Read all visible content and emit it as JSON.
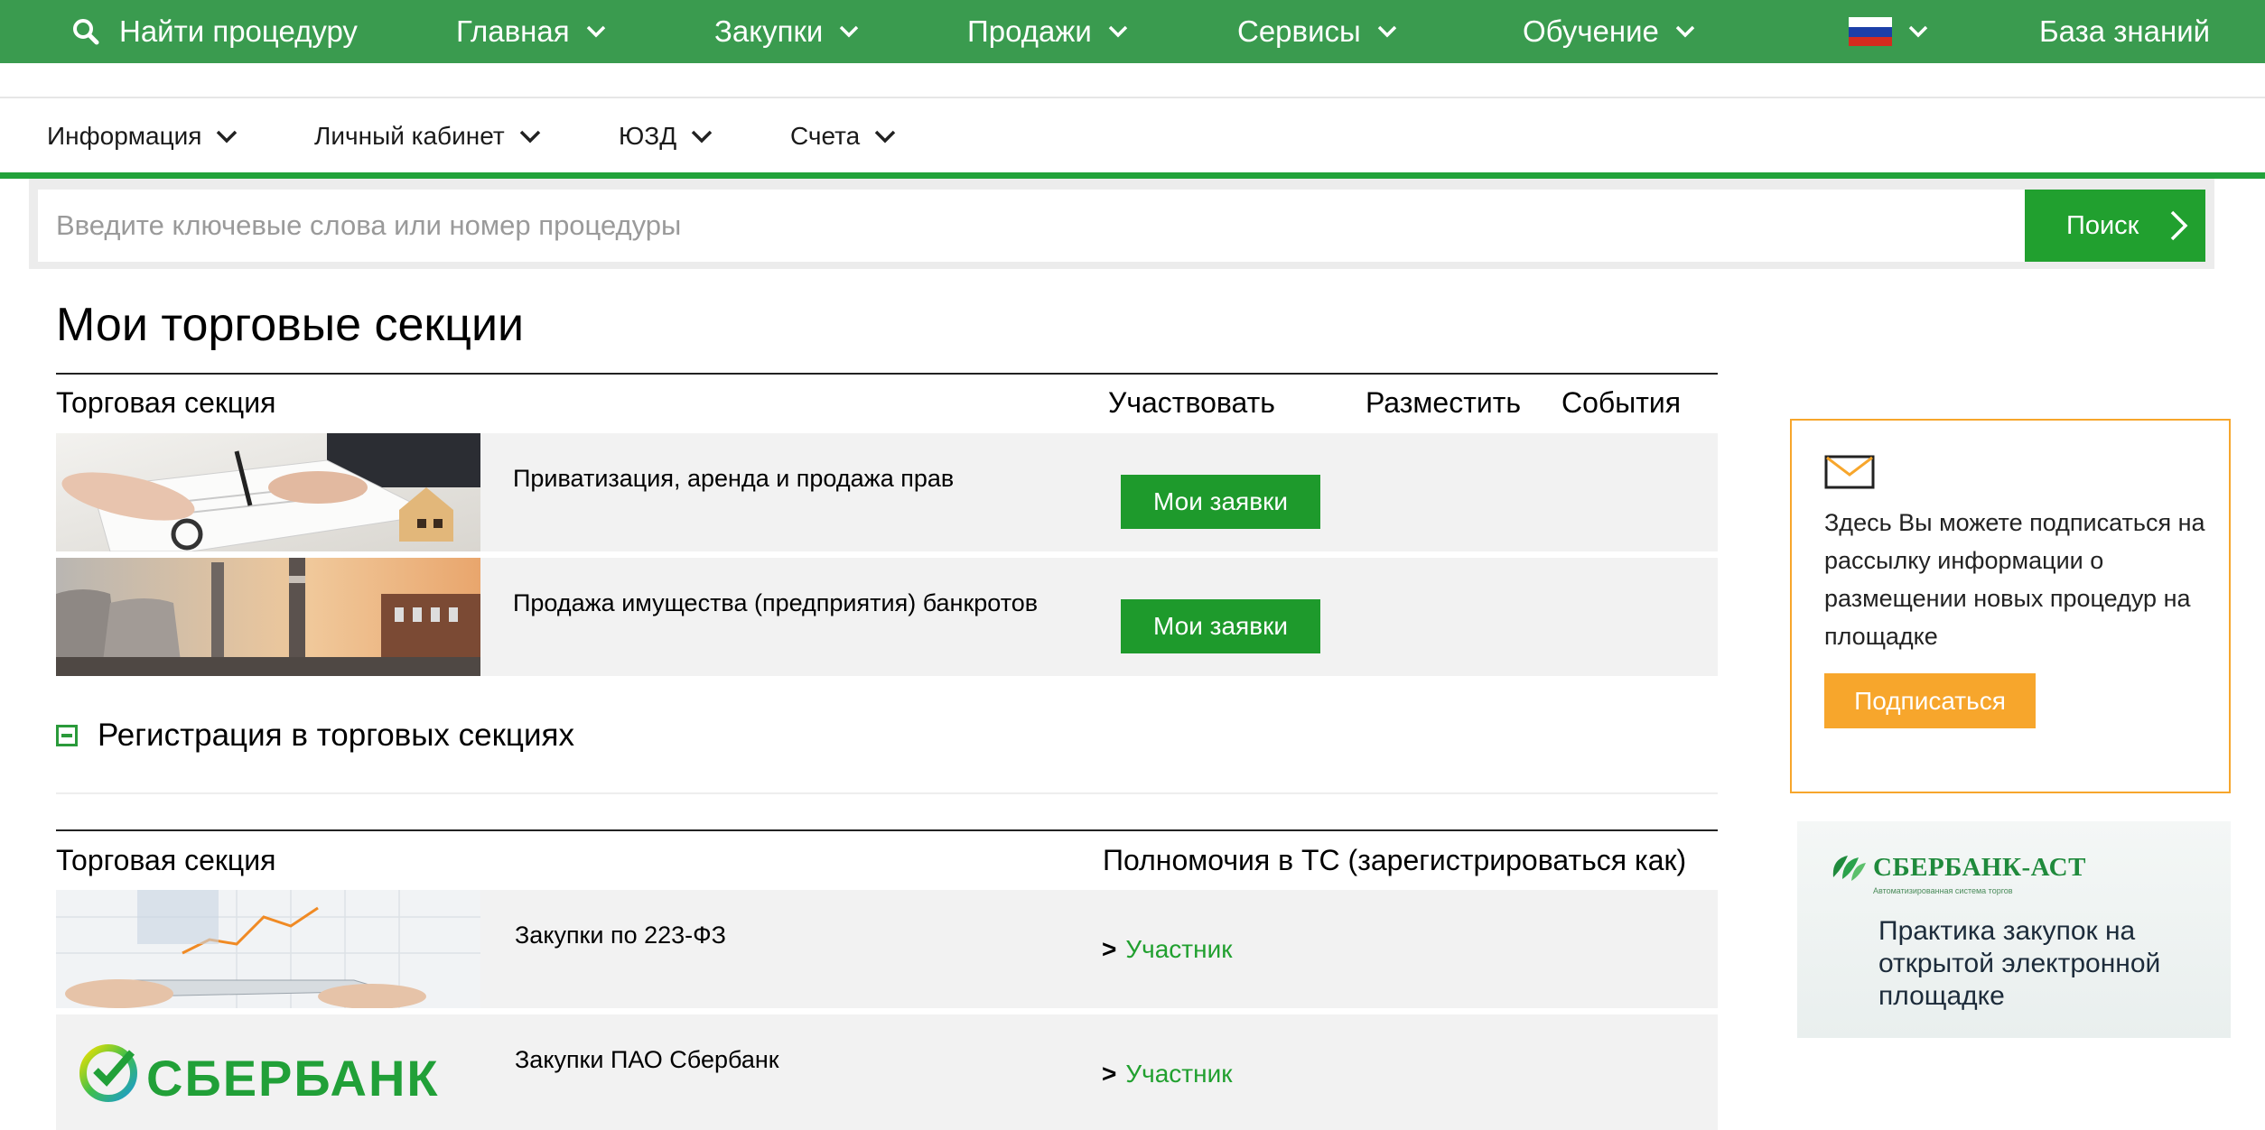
{
  "topnav": {
    "find_label": "Найти процедуру",
    "items": [
      {
        "label": "Главная"
      },
      {
        "label": "Закупки"
      },
      {
        "label": "Продажи"
      },
      {
        "label": "Сервисы"
      },
      {
        "label": "Обучение"
      }
    ],
    "language_icon": "russian-flag-icon",
    "knowledge_label": "База знаний",
    "bg_color": "#3a9b4f"
  },
  "subnav": {
    "items": [
      {
        "label": "Информация"
      },
      {
        "label": "Личный кабинет"
      },
      {
        "label": "ЮЗД"
      },
      {
        "label": "Счета"
      }
    ],
    "accent_color": "#22a23a"
  },
  "search": {
    "placeholder": "Введите ключевые слова или номер процедуры",
    "value": "",
    "button_label": "Поиск"
  },
  "sections": {
    "title": "Мои торговые секции",
    "headers": {
      "section": "Торговая секция",
      "participate": "Участвовать",
      "place": "Разместить",
      "events": "События"
    },
    "rows": [
      {
        "label": "Приватизация, аренда и продажа прав",
        "button": "Мои заявки",
        "image": "document-signing-image"
      },
      {
        "label": "Продажа имущества (предприятия) банкротов",
        "button": "Мои заявки",
        "image": "factory-image"
      }
    ]
  },
  "registration": {
    "title": "Регистрация в торговых секциях",
    "headers": {
      "section": "Торговая секция",
      "authority": "Полномочия в ТС (зарегистрироваться как)"
    },
    "rows": [
      {
        "label": "Закупки по 223-ФЗ",
        "arrow": ">",
        "role": "Участник",
        "image": "tablet-chart-image"
      },
      {
        "label": "Закупки ПАО Сбербанк",
        "arrow": ">",
        "role": "Участник",
        "image": "sberbank-logo",
        "logo_text": "СБЕРБАНК"
      }
    ]
  },
  "subscribe": {
    "icon": "envelope-icon",
    "text": "Здесь Вы можете подписаться на рассылку информации о размещении новых процедур на площадке",
    "button_label": "Подписаться",
    "accent_color": "#f7a62c"
  },
  "banner": {
    "brand": "СБЕРБАНК-АСТ",
    "tagline": "Автоматизированная система торгов",
    "headline": "Практика закупок на открытой электронной площадке"
  }
}
